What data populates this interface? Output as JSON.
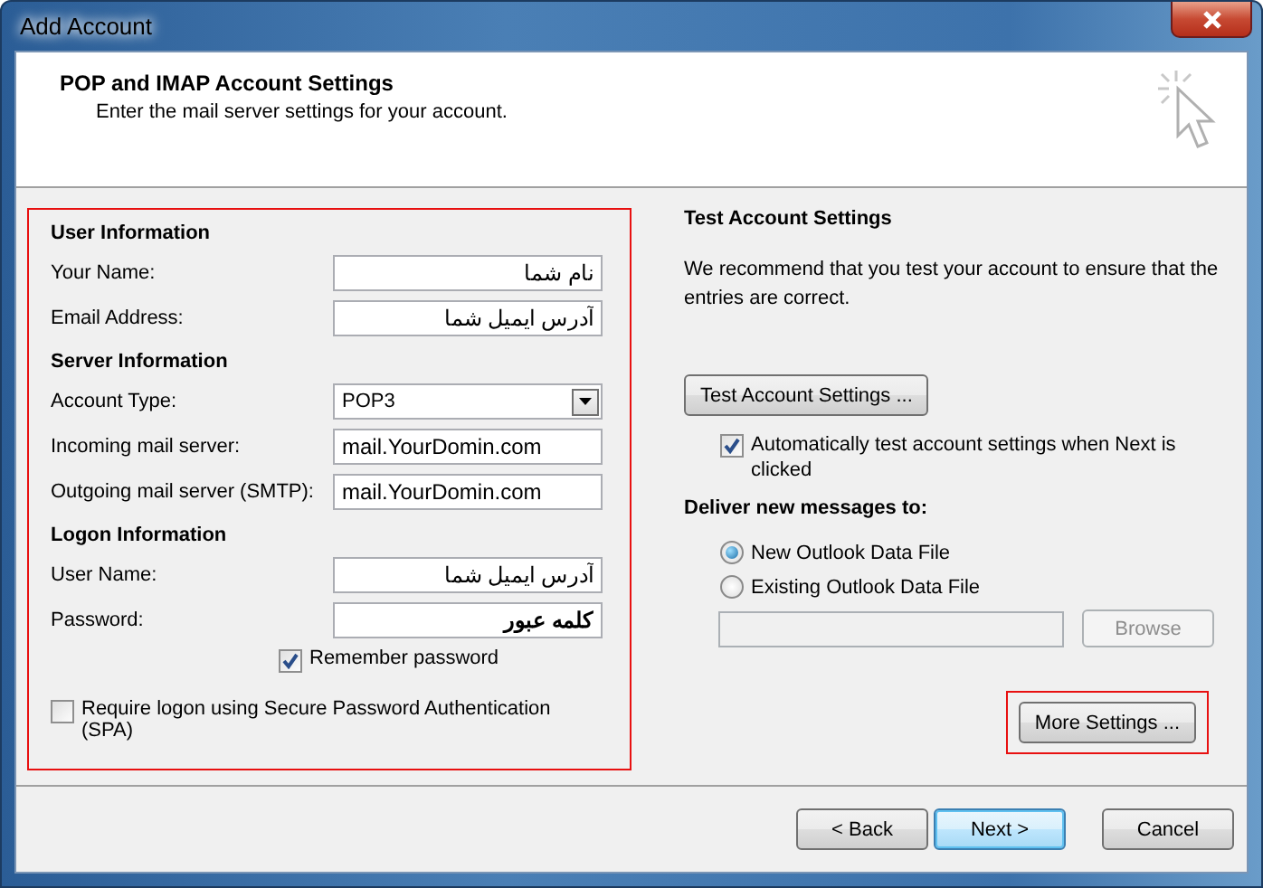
{
  "window": {
    "title": "Add Account"
  },
  "header": {
    "title": "POP and IMAP Account Settings",
    "subtitle": "Enter the mail server settings for your account."
  },
  "left_panel": {
    "sections": [
      {
        "heading": "User Information",
        "fields": [
          {
            "kind": "text",
            "label": "Your Name:",
            "value": "نام شما"
          },
          {
            "kind": "text",
            "label": "Email Address:",
            "value": "آدرس ایمیل شما"
          }
        ]
      },
      {
        "heading": "Server Information",
        "fields": [
          {
            "kind": "dropdown",
            "label": "Account Type:",
            "value": "POP3"
          },
          {
            "kind": "text",
            "label": "Incoming mail server:",
            "value": "mail.YourDomin.com"
          },
          {
            "kind": "text",
            "label": "Outgoing mail server (SMTP):",
            "value": "mail.YourDomin.com"
          }
        ]
      },
      {
        "heading": "Logon Information",
        "fields": [
          {
            "kind": "text",
            "label": "User Name:",
            "value": "آدرس ایمیل شما"
          },
          {
            "kind": "password",
            "label": "Password:",
            "value": "کلمه عبور"
          }
        ]
      }
    ],
    "remember_password": {
      "label": "Remember password",
      "checked": true
    },
    "spa": {
      "label": "Require logon using Secure Password Authentication (SPA)",
      "checked": false
    }
  },
  "right_panel": {
    "heading": "Test Account Settings",
    "description": "We recommend that you test your account to ensure that the entries are correct.",
    "test_button": "Test Account Settings ...",
    "auto_test": {
      "label": "Automatically test account settings when Next is clicked",
      "checked": true
    },
    "deliver_heading": "Deliver new messages to:",
    "deliver_options": [
      {
        "label": "New Outlook Data File",
        "selected": true
      },
      {
        "label": "Existing Outlook Data File",
        "selected": false
      }
    ],
    "browse_button": {
      "label": "Browse",
      "disabled": true
    },
    "more_settings_button": "More Settings ..."
  },
  "footer": {
    "buttons": [
      {
        "label": "< Back",
        "default": false
      },
      {
        "label": "Next >",
        "default": true
      },
      {
        "label": "Cancel",
        "default": false
      }
    ]
  }
}
